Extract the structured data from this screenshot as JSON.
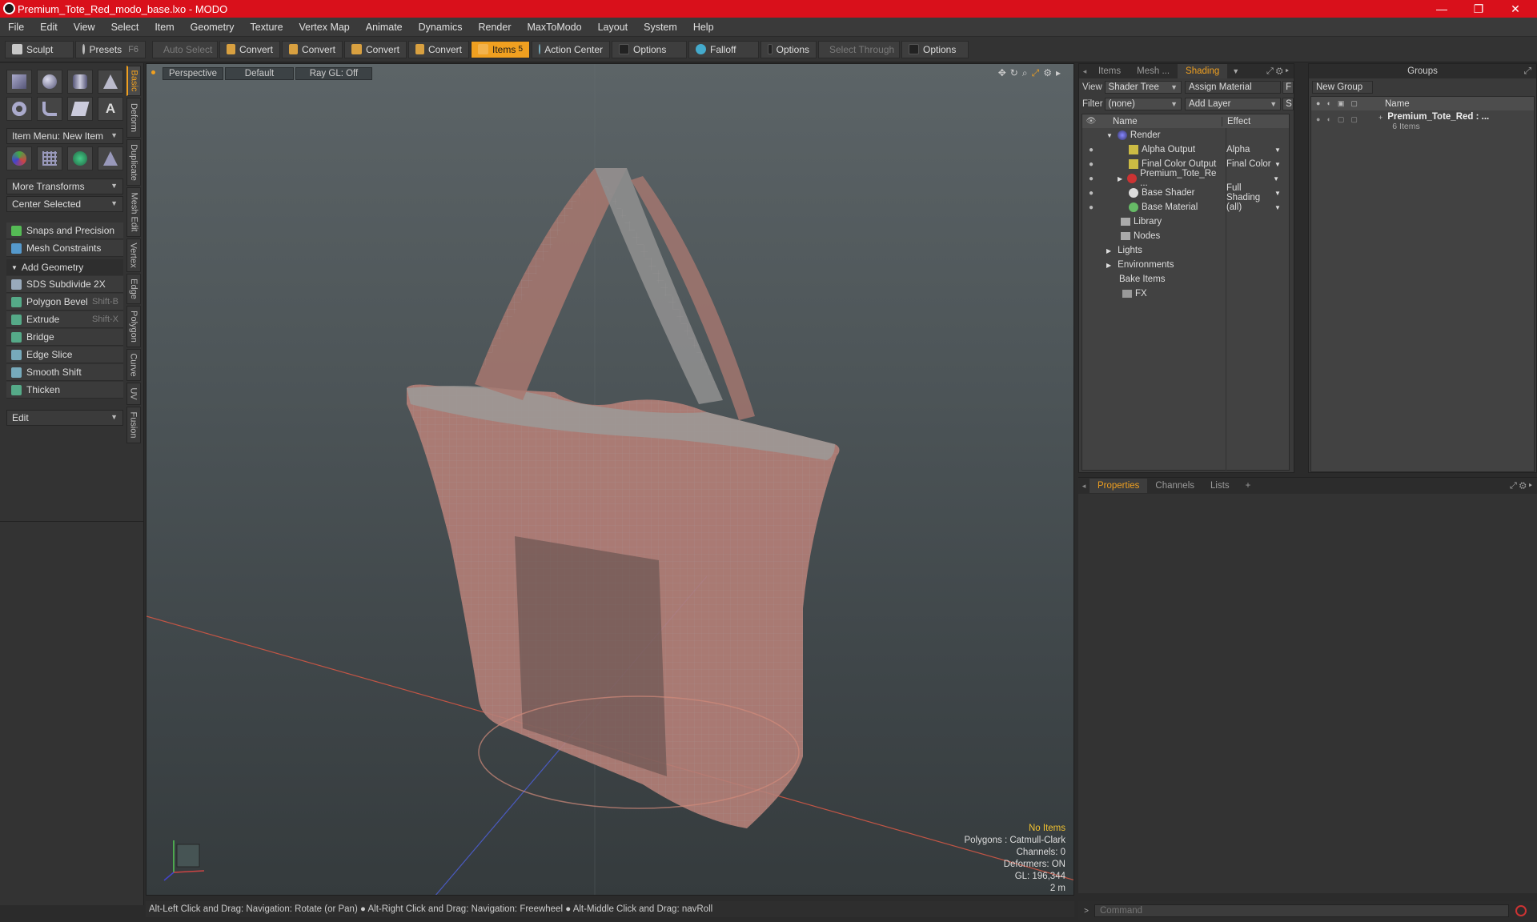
{
  "window": {
    "title": "Premium_Tote_Red_modo_base.lxo - MODO",
    "minimize": "—",
    "maximize": "❐",
    "close": "✕"
  },
  "menu": [
    "File",
    "Edit",
    "View",
    "Select",
    "Item",
    "Geometry",
    "Texture",
    "Vertex Map",
    "Animate",
    "Dynamics",
    "Render",
    "MaxToModo",
    "Layout",
    "System",
    "Help"
  ],
  "toolbar": {
    "sculpt": "Sculpt",
    "presets": "Presets",
    "presets_key": "F6",
    "auto_select": "Auto Select",
    "convert1": "Convert",
    "convert2": "Convert",
    "convert3": "Convert",
    "convert4": "Convert",
    "items": "Items",
    "items_count": "5",
    "action_center": "Action Center",
    "options1": "Options",
    "falloff": "Falloff",
    "options2": "Options",
    "select_through": "Select Through",
    "options3": "Options"
  },
  "left": {
    "item_menu": "Item Menu: New Item",
    "more_transforms": "More Transforms",
    "center_selected": "Center Selected",
    "snaps": "Snaps and Precision",
    "mesh_constraints": "Mesh Constraints",
    "add_geometry": "Add Geometry",
    "tools": [
      {
        "label": "SDS Subdivide 2X",
        "shortcut": ""
      },
      {
        "label": "Polygon Bevel",
        "shortcut": "Shift-B"
      },
      {
        "label": "Extrude",
        "shortcut": "Shift-X"
      },
      {
        "label": "Bridge",
        "shortcut": ""
      },
      {
        "label": "Edge Slice",
        "shortcut": ""
      },
      {
        "label": "Smooth Shift",
        "shortcut": ""
      },
      {
        "label": "Thicken",
        "shortcut": ""
      }
    ],
    "edit": "Edit",
    "vtabs": [
      "Basic",
      "Deform",
      "Duplicate",
      "Mesh Edit",
      "Vertex",
      "Edge",
      "Polygon",
      "Curve",
      "UV",
      "Fusion"
    ]
  },
  "viewport": {
    "perspective": "Perspective",
    "default": "Default",
    "raygl": "Ray GL: Off",
    "info": {
      "no_items": "No Items",
      "polygons": "Polygons : Catmull-Clark",
      "channels": "Channels: 0",
      "deformers": "Deformers: ON",
      "gl": "GL: 196,344",
      "scale": "2 m"
    }
  },
  "status": "Alt-Left Click and Drag: Navigation: Rotate (or Pan) ● Alt-Right Click and Drag: Navigation: Freewheel ● Alt-Middle Click and Drag: navRoll",
  "shading": {
    "tabs": [
      "Items",
      "Mesh ...",
      "Shading"
    ],
    "view_label": "View",
    "view_value": "Shader Tree",
    "assign_material": "Assign Material",
    "f_btn": "F",
    "filter_label": "Filter",
    "filter_value": "(none)",
    "add_layer": "Add Layer",
    "s_btn": "S",
    "col_name": "Name",
    "col_effect": "Effect",
    "rows": [
      {
        "name": "Render",
        "effect": ""
      },
      {
        "name": "Alpha Output",
        "effect": "Alpha"
      },
      {
        "name": "Final Color Output",
        "effect": "Final Color"
      },
      {
        "name": "Premium_Tote_Re ...",
        "effect": ""
      },
      {
        "name": "Base Shader",
        "effect": "Full Shading"
      },
      {
        "name": "Base Material",
        "effect": "(all)"
      },
      {
        "name": "Library",
        "effect": ""
      },
      {
        "name": "Nodes",
        "effect": ""
      },
      {
        "name": "Lights",
        "effect": ""
      },
      {
        "name": "Environments",
        "effect": ""
      },
      {
        "name": "Bake Items",
        "effect": ""
      },
      {
        "name": "FX",
        "effect": ""
      }
    ]
  },
  "groups": {
    "title": "Groups",
    "new_group": "New Group",
    "col_name": "Name",
    "item_name": "Premium_Tote_Red : ...",
    "item_count": "6 Items"
  },
  "properties": {
    "tabs": [
      "Properties",
      "Channels",
      "Lists"
    ],
    "add": "+"
  },
  "command": {
    "placeholder": "Command"
  }
}
